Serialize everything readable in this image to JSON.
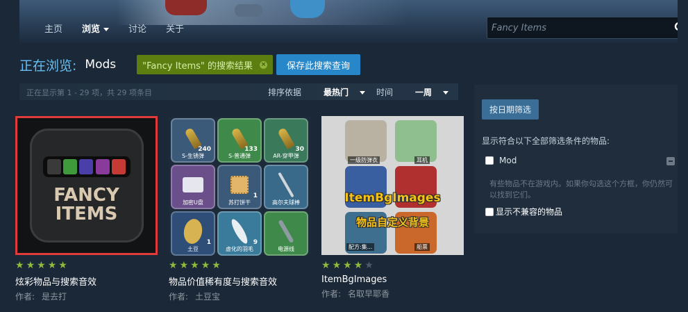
{
  "header": {
    "nav": [
      {
        "label": "主页"
      },
      {
        "label": "浏览"
      },
      {
        "label": "讨论"
      },
      {
        "label": "关于"
      }
    ],
    "search_placeholder": "Fancy Items"
  },
  "browse": {
    "label": "正在浏览:",
    "category": "Mods",
    "search_tag": "\"Fancy Items\" 的搜索结果",
    "save_query": "保存此搜索查询"
  },
  "sortbar": {
    "count_text": "正在显示第 1 - 29 项，共 29 项条目",
    "sort_label": "排序依据",
    "sort_value": "最热门",
    "time_label": "时间",
    "time_value": "一周"
  },
  "items": [
    {
      "title": "炫彩物品与搜索音效",
      "author_label": "作者:",
      "author": "是去打",
      "rating": 5,
      "thumb_text": "FANCY ITEMS",
      "thumb_line1": "FANCY",
      "thumb_line2": "ITEMS",
      "bar_colors": [
        "#3a3a3a",
        "#3e9a3a",
        "#4a3fa8",
        "#8a3a9a",
        "#c53a34"
      ]
    },
    {
      "title": "物品价值稀有度与搜索音效",
      "author_label": "作者:",
      "author": "土豆宝",
      "rating": 5,
      "slots": [
        {
          "name": "S-生锈弹",
          "count": "240",
          "color": "#3b5a7a",
          "icon": "bullet-icon"
        },
        {
          "name": "S-普通弹",
          "count": "133",
          "color": "#3f8a4a",
          "icon": "bullet-icon"
        },
        {
          "name": "AR-穿甲弹",
          "count": "30",
          "color": "#3a7a5a",
          "icon": "bullet-icon"
        },
        {
          "name": "加密U盘",
          "count": "",
          "color": "#6a4f8a",
          "icon": "usb-icon"
        },
        {
          "name": "苏打饼干",
          "count": "1",
          "color": "#3b5a7a",
          "icon": "cracker-icon"
        },
        {
          "name": "高尔夫球棒",
          "count": "",
          "color": "#3a6a8a",
          "icon": "golf-club-icon"
        },
        {
          "name": "土豆",
          "count": "1",
          "color": "#2e4e78",
          "icon": "potato-icon"
        },
        {
          "name": "虚化的羽毛",
          "count": "9",
          "color": "#3a7a9a",
          "icon": "feather-icon"
        },
        {
          "name": "电源线",
          "count": "",
          "color": "#3f8a4a",
          "icon": "cable-icon"
        }
      ]
    },
    {
      "title": "ItemBgImages",
      "author_label": "作者:",
      "author": "名取早耶香",
      "rating": 4,
      "thumb_title": "ItemBgImages",
      "thumb_sub": "物品自定义背景",
      "cell_labels": [
        "一级防弹衣",
        "耳机",
        "配方:集...",
        "船票"
      ]
    }
  ],
  "panel": {
    "date_filter": "按日期筛选",
    "match_all": "显示符合以下全部筛选条件的物品:",
    "mod_label": "Mod",
    "note": "有些物品不在游戏内。如果你勾选这个方框，你仍然可以找到它们。",
    "incompatible": "显示不兼容的物品"
  },
  "colors": {
    "background": "#1b2838",
    "accent_blue": "#66c0f4",
    "tag_green": "#5c7e10",
    "save_blue": "#2887c8",
    "star_green": "#90ba3c",
    "highlight_red": "#e03b3b"
  }
}
